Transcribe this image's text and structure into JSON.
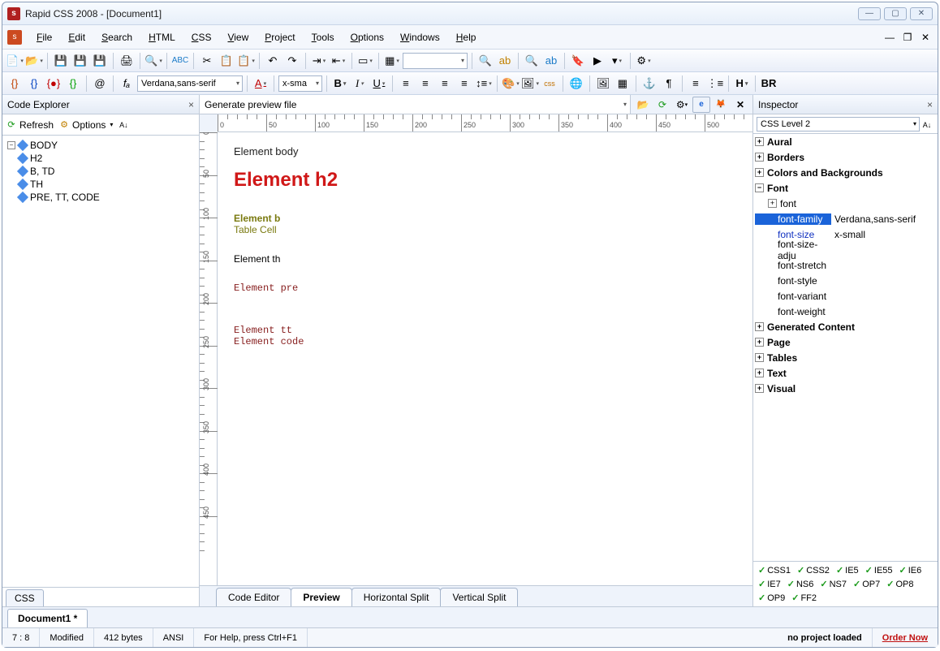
{
  "window": {
    "title": "Rapid CSS 2008 - [Document1]"
  },
  "menu": [
    "File",
    "Edit",
    "Search",
    "HTML",
    "CSS",
    "View",
    "Project",
    "Tools",
    "Options",
    "Windows",
    "Help"
  ],
  "toolbar2": {
    "font_combo": "Verdana,sans-serif",
    "size_combo": "x-sma",
    "br_label": "BR"
  },
  "left": {
    "title": "Code Explorer",
    "refresh": "Refresh",
    "options": "Options",
    "items": [
      "BODY",
      "H2",
      "B, TD",
      "TH",
      "PRE, TT, CODE"
    ],
    "css_tab": "CSS"
  },
  "center": {
    "addr": "Generate preview file",
    "ruler_labels": [
      "0",
      "50",
      "100",
      "150",
      "200",
      "250",
      "300",
      "350",
      "400",
      "450",
      "500"
    ],
    "vruler_labels": [
      "0",
      "50",
      "100",
      "150",
      "200",
      "250",
      "300",
      "350",
      "400",
      "450"
    ],
    "preview": {
      "body": "Element body",
      "h2": "Element h2",
      "b": "Element b",
      "td": "Table Cell",
      "th": "Element th",
      "pre": "Element pre",
      "tt": "Element tt",
      "code": "Element code"
    },
    "tabs": [
      "Code Editor",
      "Preview",
      "Horizontal Split",
      "Vertical Split"
    ]
  },
  "right": {
    "title": "Inspector",
    "level": "CSS Level 2",
    "cats": {
      "aural": "Aural",
      "borders": "Borders",
      "colors": "Colors and Backgrounds",
      "font": "Font",
      "gen": "Generated Content",
      "page": "Page",
      "tables": "Tables",
      "text": "Text",
      "visual": "Visual"
    },
    "font_sub": "font",
    "props": {
      "font_family": {
        "n": "font-family",
        "v": "Verdana,sans-serif"
      },
      "font_size": {
        "n": "font-size",
        "v": "x-small"
      },
      "font_size_adjust": {
        "n": "font-size-adju",
        "v": ""
      },
      "font_stretch": {
        "n": "font-stretch",
        "v": ""
      },
      "font_style": {
        "n": "font-style",
        "v": ""
      },
      "font_variant": {
        "n": "font-variant",
        "v": ""
      },
      "font_weight": {
        "n": "font-weight",
        "v": ""
      }
    },
    "compat": [
      "CSS1",
      "CSS2",
      "IE5",
      "IE55",
      "IE6",
      "IE7",
      "NS6",
      "NS7",
      "OP7",
      "OP8",
      "OP9",
      "FF2"
    ]
  },
  "doctab": "Document1 *",
  "status": {
    "pos": "7 : 8",
    "mod": "Modified",
    "size": "412 bytes",
    "enc": "ANSI",
    "help": "For Help, press Ctrl+F1",
    "proj": "no project loaded",
    "order": "Order Now"
  }
}
